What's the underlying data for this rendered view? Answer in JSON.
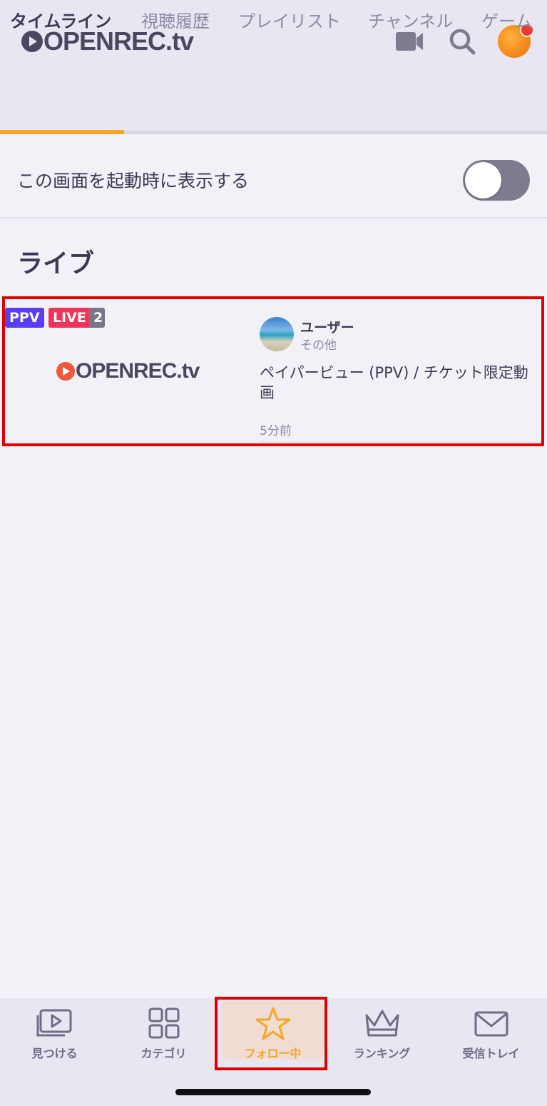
{
  "header": {
    "logo": "OPENREC.tv",
    "icons": [
      "video-camera-icon",
      "search-icon",
      "avatar"
    ]
  },
  "tabs": [
    {
      "label": "タイムライン",
      "active": true
    },
    {
      "label": "視聴履歴",
      "active": false
    },
    {
      "label": "プレイリスト",
      "active": false
    },
    {
      "label": "チャンネル",
      "active": false
    },
    {
      "label": "ゲーム",
      "active": false
    }
  ],
  "settings": {
    "show_on_launch_label": "この画面を起動時に表示する",
    "show_on_launch_enabled": false
  },
  "live_section": {
    "title": "ライブ",
    "items": [
      {
        "badge_ppv": "PPV",
        "badge_live": "LIVE",
        "badge_count": "2",
        "thumbnail_logo": "OPENREC.tv",
        "channel_name": "ユーザー",
        "category": "その他",
        "title": "ペイパービュー (PPV) / チケット限定動画",
        "time": "5分前"
      }
    ]
  },
  "bottom_nav": [
    {
      "label": "見つける",
      "icon": "discover-icon",
      "active": false
    },
    {
      "label": "カテゴリ",
      "icon": "category-grid-icon",
      "active": false
    },
    {
      "label": "フォロー中",
      "icon": "star-icon",
      "active": true
    },
    {
      "label": "ランキング",
      "icon": "crown-icon",
      "active": false
    },
    {
      "label": "受信トレイ",
      "icon": "mail-icon",
      "active": false
    }
  ],
  "colors": {
    "accent": "#f5a623",
    "ppv": "#5b3df5",
    "live": "#f0345a",
    "highlight_box": "#e00000"
  }
}
